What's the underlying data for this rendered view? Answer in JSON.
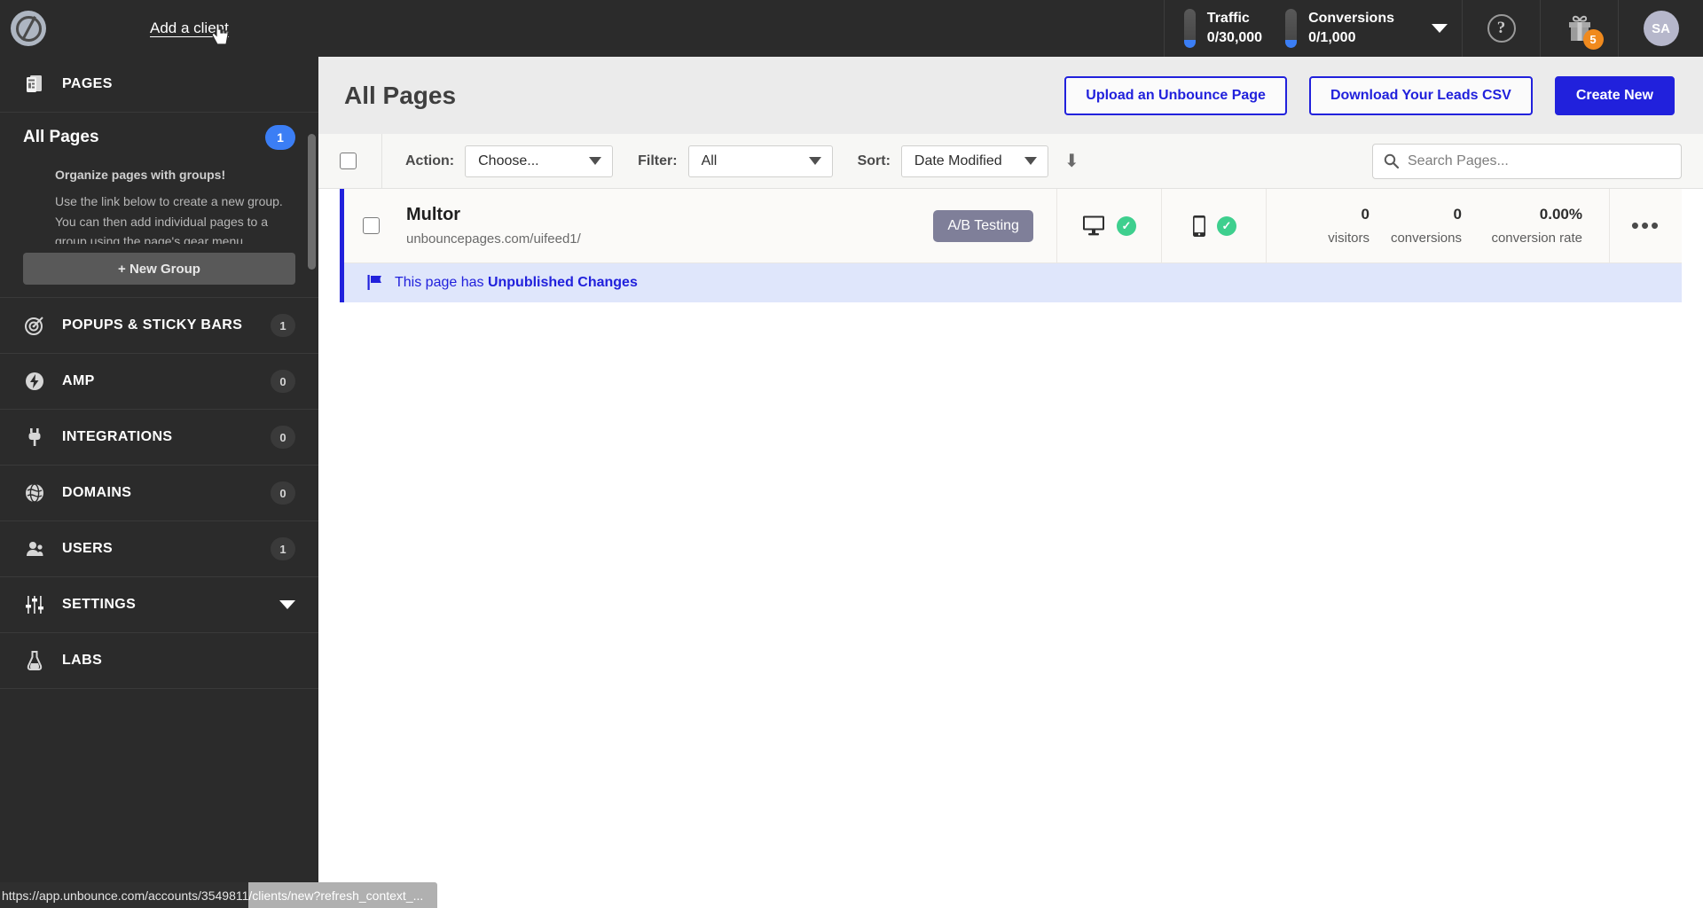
{
  "topbar": {
    "logo_name": "unbounce-logo",
    "add_client_label": "Add a client",
    "usage": [
      {
        "label": "Traffic",
        "value": "0/30,000"
      },
      {
        "label": "Conversions",
        "value": "0/1,000"
      }
    ],
    "help_label": "?",
    "gift_badge": "5",
    "avatar_initials": "SA"
  },
  "sidebar": {
    "pages_section": {
      "label": "PAGES",
      "icon": "pages-icon",
      "all_pages_label": "All Pages",
      "all_pages_count": "1",
      "hint_title": "Organize pages with groups!",
      "hint_body": "Use the link below to create a new group. You can then add individual pages to a group using the page's gear menu.",
      "new_group_label": "+ New Group"
    },
    "items": [
      {
        "label": "POPUPS & STICKY BARS",
        "count": "1",
        "icon": "target-icon"
      },
      {
        "label": "AMP",
        "count": "0",
        "icon": "bolt-icon"
      },
      {
        "label": "INTEGRATIONS",
        "count": "0",
        "icon": "plug-icon"
      },
      {
        "label": "DOMAINS",
        "count": "0",
        "icon": "globe-icon"
      },
      {
        "label": "USERS",
        "count": "1",
        "icon": "users-icon"
      },
      {
        "label": "SETTINGS",
        "count": "",
        "icon": "sliders-icon"
      },
      {
        "label": "LABS",
        "count": "",
        "icon": "flask-icon"
      }
    ]
  },
  "main": {
    "title": "All Pages",
    "buttons": {
      "upload": "Upload an Unbounce Page",
      "download": "Download Your Leads CSV",
      "create": "Create New"
    },
    "toolbar": {
      "action_label": "Action:",
      "action_value": "Choose...",
      "filter_label": "Filter:",
      "filter_value": "All",
      "sort_label": "Sort:",
      "sort_value": "Date Modified",
      "sort_direction_icon": "arrow-down-icon",
      "search_placeholder": "Search Pages...",
      "search_value": ""
    },
    "rows": [
      {
        "title": "Multor",
        "url": "unbouncepages.com/uifeed1/",
        "badge": "A/B Testing",
        "desktop_status": "published",
        "mobile_status": "published",
        "stats": [
          {
            "num": "0",
            "cap": "visitors"
          },
          {
            "num": "0",
            "cap": "conversions"
          },
          {
            "num": "0.00%",
            "cap": "conversion rate"
          }
        ],
        "menu_label": "•••",
        "notice_prefix": "This page has ",
        "notice_strong": "Unpublished Changes"
      }
    ]
  },
  "statusbar": {
    "url_dark": "https://app.unbounce.com/accounts/3549811",
    "url_light": "/clients/new?refresh_context_..."
  },
  "colors": {
    "accent_blue": "#2121dc",
    "badge_blue": "#3b7ef5",
    "badge_orange": "#f08a1e",
    "ab_badge": "#7f7f99",
    "success_green": "#3ecf8e",
    "sidebar_bg": "#2b2b2b"
  }
}
